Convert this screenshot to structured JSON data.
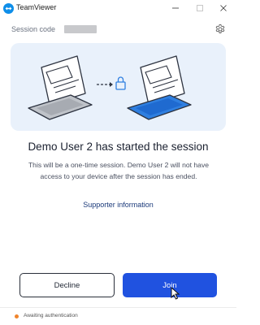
{
  "window": {
    "title": "TeamViewer"
  },
  "session": {
    "label": "Session code",
    "code_redacted": true
  },
  "main": {
    "headline": "Demo User 2 has started the session",
    "description": "This will be a one-time session. Demo User 2 will not have access to your device after the session has ended.",
    "supporter_link": "Supporter information"
  },
  "actions": {
    "decline_label": "Decline",
    "join_label": "Join"
  },
  "status": {
    "text": "Awaiting authentication",
    "color": "#f0842c"
  },
  "colors": {
    "accent": "#2052e0",
    "brand": "#0e8ee9",
    "illustration_bg": "#e9f1fb"
  },
  "icons": {
    "logo": "teamviewer-logo-icon",
    "settings": "gear-icon",
    "lock": "lock-icon",
    "minimize": "minimize-icon",
    "maximize": "maximize-icon",
    "close": "close-icon"
  }
}
